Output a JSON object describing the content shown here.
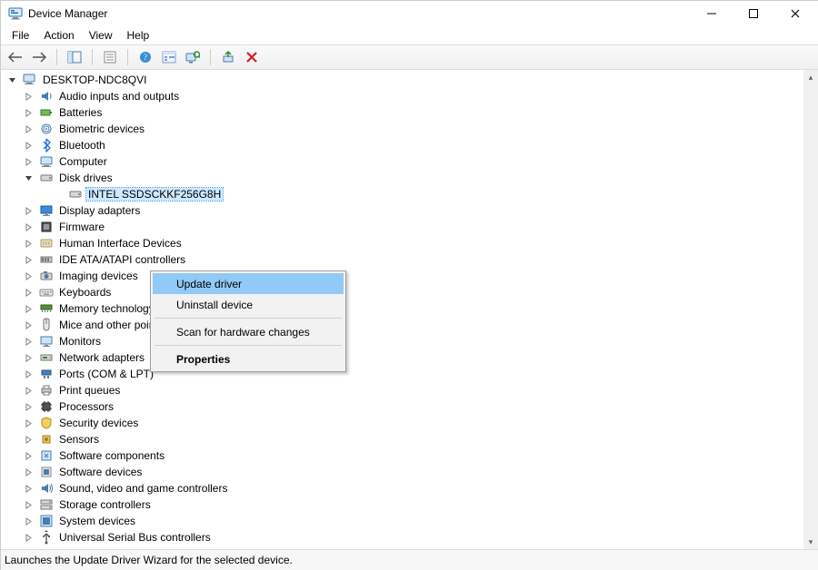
{
  "window": {
    "title": "Device Manager"
  },
  "menus": {
    "file": "File",
    "action": "Action",
    "view": "View",
    "help": "Help"
  },
  "toolbar": {
    "back": "Back",
    "forward": "Forward",
    "show_hide_tree": "Show/Hide Console Tree",
    "properties": "Properties",
    "help": "Help",
    "show_hidden": "Show hidden devices",
    "scan": "Scan for hardware changes",
    "update": "Update driver",
    "uninstall": "Uninstall device"
  },
  "tree": {
    "root": "DESKTOP-NDC8QVI",
    "items": [
      {
        "label": "Audio inputs and outputs",
        "icon": "audio"
      },
      {
        "label": "Batteries",
        "icon": "battery"
      },
      {
        "label": "Biometric devices",
        "icon": "biometric"
      },
      {
        "label": "Bluetooth",
        "icon": "bluetooth"
      },
      {
        "label": "Computer",
        "icon": "computer"
      },
      {
        "label": "Disk drives",
        "icon": "disk",
        "expanded": true,
        "children": [
          {
            "label": "INTEL SSDSCKKF256G8H",
            "icon": "disk",
            "selected": true
          }
        ]
      },
      {
        "label": "Display adapters",
        "icon": "display"
      },
      {
        "label": "Firmware",
        "icon": "firmware"
      },
      {
        "label": "Human Interface Devices",
        "icon": "hid"
      },
      {
        "label": "IDE ATA/ATAPI controllers",
        "icon": "ide"
      },
      {
        "label": "Imaging devices",
        "icon": "imaging"
      },
      {
        "label": "Keyboards",
        "icon": "keyboard"
      },
      {
        "label": "Memory technology devices",
        "icon": "memory"
      },
      {
        "label": "Mice and other pointing devices",
        "icon": "mouse"
      },
      {
        "label": "Monitors",
        "icon": "monitor"
      },
      {
        "label": "Network adapters",
        "icon": "network"
      },
      {
        "label": "Ports (COM & LPT)",
        "icon": "port"
      },
      {
        "label": "Print queues",
        "icon": "printer"
      },
      {
        "label": "Processors",
        "icon": "cpu"
      },
      {
        "label": "Security devices",
        "icon": "security"
      },
      {
        "label": "Sensors",
        "icon": "sensor"
      },
      {
        "label": "Software components",
        "icon": "swcomp"
      },
      {
        "label": "Software devices",
        "icon": "swdev"
      },
      {
        "label": "Sound, video and game controllers",
        "icon": "sound"
      },
      {
        "label": "Storage controllers",
        "icon": "storage"
      },
      {
        "label": "System devices",
        "icon": "system"
      },
      {
        "label": "Universal Serial Bus controllers",
        "icon": "usb"
      }
    ]
  },
  "context_menu": {
    "update": "Update driver",
    "uninstall": "Uninstall device",
    "scan": "Scan for hardware changes",
    "properties": "Properties"
  },
  "statusbar": {
    "text": "Launches the Update Driver Wizard for the selected device."
  }
}
